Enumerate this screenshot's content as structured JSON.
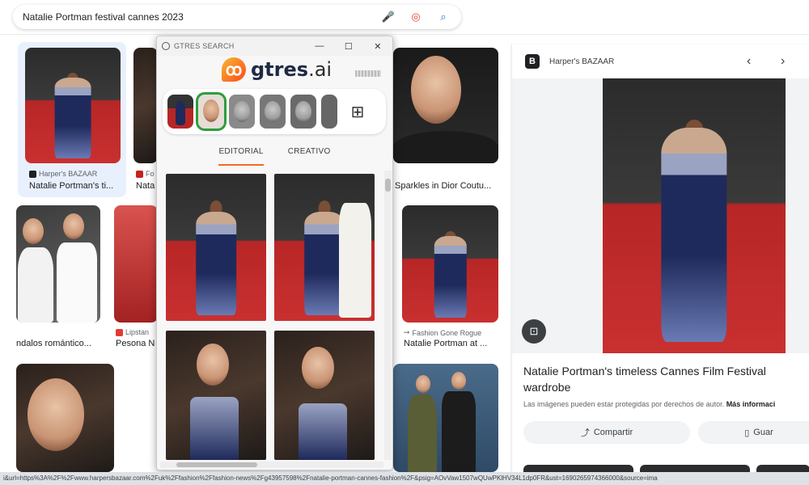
{
  "search": {
    "query": "Natalie Portman festival cannes 2023"
  },
  "results": [
    {
      "source": "Harper's BAZAAR",
      "title": "Natalie Portman's ti..."
    },
    {
      "source": "Fo",
      "title": "Nata"
    },
    {
      "source": "",
      "title": "Sparkles in Dior Coutu..."
    },
    {
      "source": "",
      "title": "ndalos romántico..."
    },
    {
      "source": "Lipstan",
      "title": "Pesona N"
    },
    {
      "source": "Fashion Gone Rogue",
      "title": "Natalie Portman at ..."
    }
  ],
  "gtres": {
    "window_title": "GTRES SEARCH",
    "logo_text": "gtres",
    "logo_suffix": ".ai",
    "tabs": [
      "EDITORIAL",
      "CREATIVO"
    ],
    "active_tab": "EDITORIAL"
  },
  "panel": {
    "source": "Harper's BAZAAR",
    "title": "Natalie Portman's timeless Cannes Film Festival wardrobe",
    "note": "Las imágenes pueden estar protegidas por derechos de autor.",
    "more_info": "Más informaci",
    "share_label": "Compartir",
    "save_label": "Guar"
  },
  "status_url": "i&url=https%3A%2F%2Fwww.harpersbazaar.com%2Fuk%2Ffashion%2Ffashion-news%2Fg43957598%2Fnatalie-portman-cannes-fashion%2F&psig=AOvVaw1507wQUwPKlHV34L1dp0FR&ust=1690265974366000&source=ima",
  "colors": {
    "accent_orange": "#f26b21",
    "selected_green": "#2e9d3c",
    "link_blue": "#1a73e8"
  }
}
